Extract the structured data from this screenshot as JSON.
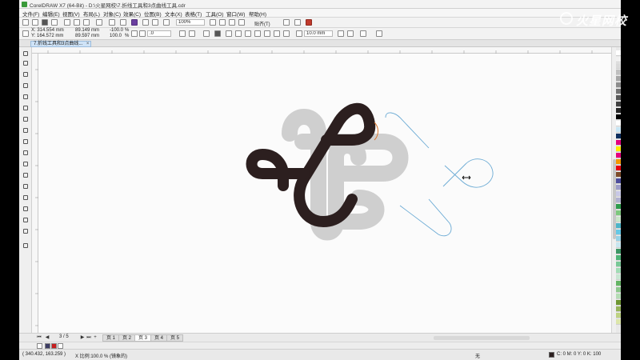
{
  "window": {
    "title": "CorelDRAW X7 (64-Bit) - D:\\火星网校\\7.折线工具和3点曲线工具.cdr"
  },
  "menu": [
    "文件(F)",
    "编辑(E)",
    "视图(V)",
    "布局(L)",
    "对象(C)",
    "效果(C)",
    "位图(B)",
    "文本(X)",
    "表格(T)",
    "工具(O)",
    "窗口(W)",
    "帮助(H)"
  ],
  "toolbar": {
    "zoom": "100%",
    "snap_label": "贴齐(T)"
  },
  "property_bar": {
    "x": "X: 314.554 mm",
    "y": "Y: 164.572 mm",
    "width": "89.149 mm",
    "height": "89.597 mm",
    "scale_x": "-100.0",
    "scale_y": "100.0",
    "percent": "%",
    "rotation": ".0",
    "outline_width": "10.0 mm"
  },
  "document_tab": {
    "label": "7.折线工具和3点曲线..."
  },
  "pages": {
    "counter": "3 / 5",
    "tabs": [
      "页 1",
      "页 2",
      "页 3",
      "页 4",
      "页 5"
    ],
    "active_index": 2
  },
  "status": {
    "cursor": "( 340.432, 163.259 )",
    "scale_info": "X 比例:100.0 % (镜象的)",
    "outline_none": "无",
    "fill_info": "C: 0 M: 0 Y: 0 K: 100"
  },
  "watermark": {
    "brand": "火星网校"
  },
  "colors": {
    "accent": "#2c1f1f",
    "ghost": "#cfcfcf",
    "guide": "#6aaad4",
    "palette": [
      "#ffffff",
      "#f0f0f0",
      "#d9d9d9",
      "#bfbfbf",
      "#a6a6a6",
      "#8c8c8c",
      "#737373",
      "#595959",
      "#404040",
      "#262626",
      "#000000",
      "#ffffff",
      "#c8e6f5",
      "#0b2d5e",
      "#e3007f",
      "#ffed00",
      "#e6007e",
      "#f39800",
      "#e60012",
      "#7d4b2a",
      "#4c4c9c",
      "#9c9cc8",
      "#c8c8e6",
      "#b0b0d0",
      "#2e9c4c",
      "#7cc87c",
      "#c8e6c8",
      "#4cb4c8",
      "#64c8e6",
      "#96d2e6",
      "#c8e6f0",
      "#3c9664",
      "#50b478",
      "#78c896",
      "#a0dcb4",
      "#c8e6d2",
      "#64b464",
      "#8cc88c",
      "#b4dcb4",
      "#6e9632",
      "#96b45a",
      "#bed282",
      "#dce6aa"
    ]
  }
}
